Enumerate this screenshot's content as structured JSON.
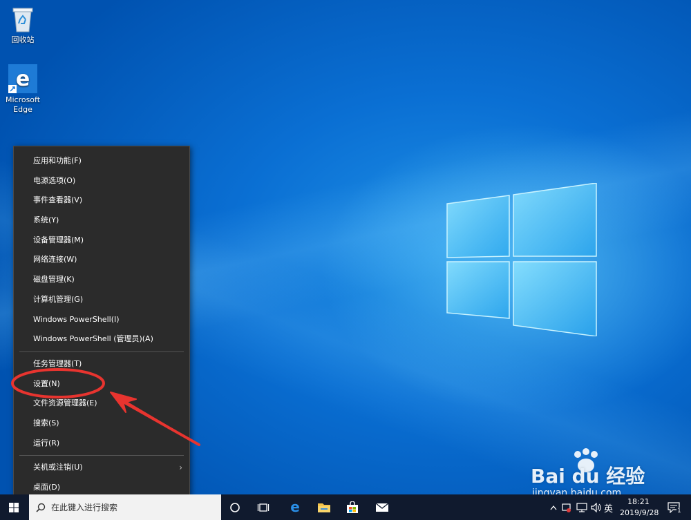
{
  "desktop": {
    "icons": [
      {
        "label": "回收站"
      },
      {
        "label": "Microsoft Edge"
      }
    ]
  },
  "context_menu": {
    "items": [
      {
        "label": "应用和功能(F)"
      },
      {
        "label": "电源选项(O)"
      },
      {
        "label": "事件查看器(V)"
      },
      {
        "label": "系统(Y)"
      },
      {
        "label": "设备管理器(M)"
      },
      {
        "label": "网络连接(W)"
      },
      {
        "label": "磁盘管理(K)"
      },
      {
        "label": "计算机管理(G)"
      },
      {
        "label": "Windows PowerShell(I)"
      },
      {
        "label": "Windows PowerShell (管理员)(A)"
      },
      {
        "label": "任务管理器(T)"
      },
      {
        "label": "设置(N)"
      },
      {
        "label": "文件资源管理器(E)"
      },
      {
        "label": "搜索(S)"
      },
      {
        "label": "运行(R)"
      },
      {
        "label": "关机或注销(U)"
      },
      {
        "label": "桌面(D)"
      }
    ]
  },
  "taskbar": {
    "search_placeholder": "在此键入进行搜索",
    "ime": "英",
    "time": "18:21",
    "date": "2019/9/28",
    "notification_count": "1"
  },
  "watermark": {
    "brand": "Bai du 经验",
    "url": "jingyan.baidu.com"
  },
  "colors": {
    "menu_bg": "#2b2b2b",
    "annotation_red": "#e8342f",
    "taskbar_bg": "#101a2e",
    "edge_blue": "#1e7bd6"
  }
}
